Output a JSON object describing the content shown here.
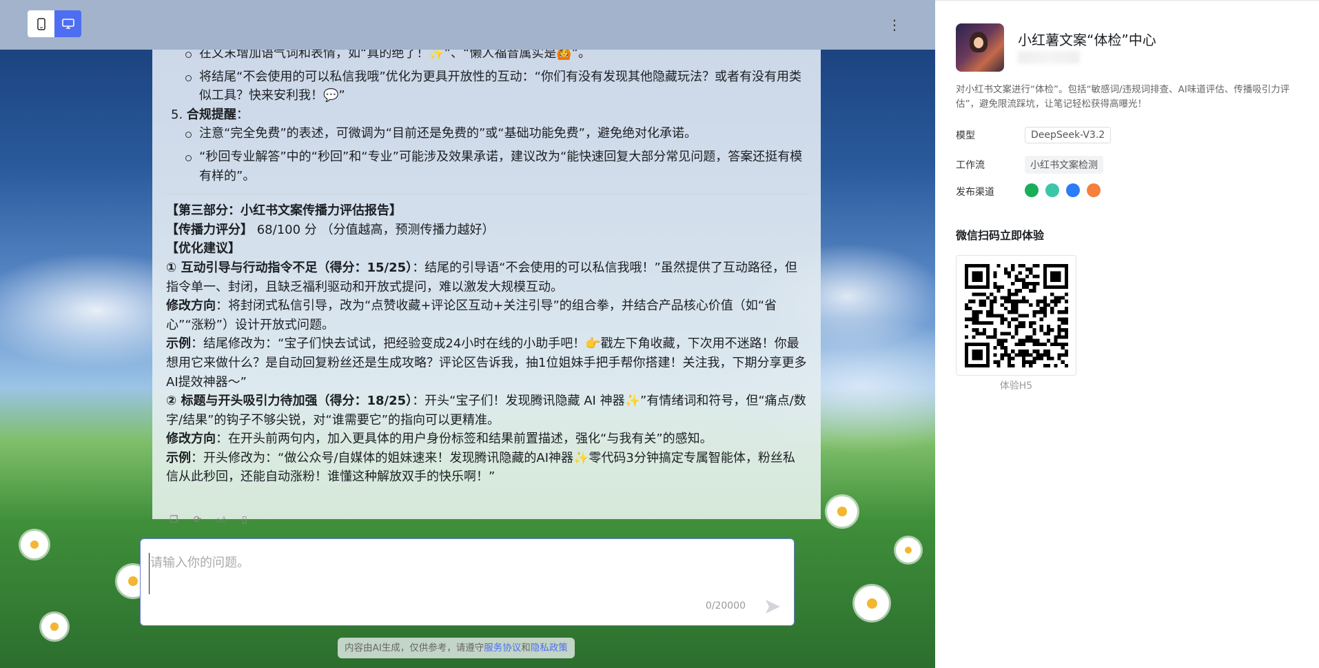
{
  "toolbar": {
    "mobile_icon": "mobile-phone-icon",
    "desktop_icon": "desktop-monitor-icon",
    "more_icon": "more-vertical-icon",
    "more_glyph": "⋮"
  },
  "chat": {
    "partial_line": "在文末增加语气词和表情，如“真的绝了！✨”、“懒人福音属实是🙆”。",
    "bullet_interaction": "将结尾“不会使用的可以私信我哦”优化为更具开放性的互动：“你们有没有发现其他隐藏玩法？或者有没有用类似工具？快来安利我！💬”",
    "item5_num": "5.",
    "item5_title": "合规提醒",
    "item5_colon": "：",
    "item5_bullets": [
      "注意“完全免费”的表述，可微调为“目前还是免费的”或“基础功能免费”，避免绝对化承诺。",
      "“秒回专业解答”中的“秒回”和“专业”可能涉及效果承诺，建议改为“能快速回复大部分常见问题，答案还挺有模有样的”。"
    ],
    "part3_title": "【第三部分：小红书文案传播力评估报告】",
    "score_label": "【传播力评分】",
    "score_value": " 68/100 分 （分值越高，预测传播力越好）",
    "suggest_label": "【优化建议】",
    "s1_title": "① 互动引导与行动指令不足（得分：15/25）",
    "s1_text": "：结尾的引导语“不会使用的可以私信我哦！”虽然提供了互动路径，但指令单一、封闭，且缺乏福利驱动和开放式提问，难以激发大规模互动。",
    "s1_dir_label": "修改方向",
    "s1_dir_text": "：将封闭式私信引导，改为“点赞收藏+评论区互动+关注引导”的组合拳，并结合产品核心价值（如“省心”“涨粉”）设计开放式问题。",
    "s1_ex_label": "示例",
    "s1_ex_text": "：结尾修改为：“宝子们快去试试，把经验变成24小时在线的小助手吧！👉戳左下角收藏，下次用不迷路！你最想用它来做什么？是自动回复粉丝还是生成攻略？评论区告诉我，抽1位姐妹手把手帮你搭建！关注我，下期分享更多AI提效神器～”",
    "s2_title": "② 标题与开头吸引力待加强（得分：18/25）",
    "s2_text": "：开头“宝子们！发现腾讯隐藏 AI 神器✨”有情绪词和符号，但“痛点/数字/结果”的钩子不够尖锐，对“谁需要它”的指向可以更精准。",
    "s2_dir_label": "修改方向",
    "s2_dir_text": "：在开头前两句内，加入更具体的用户身份标签和结果前置描述，强化“与我有关”的感知。",
    "s2_ex_label": "示例",
    "s2_ex_text": "：开头修改为：“做公众号/自媒体的姐妹速来！发现腾讯隐藏的AI神器✨零代码3分钟搞定专属智能体，粉丝私信从此秒回，还能自动涨粉！谁懂这种解放双手的快乐啊！”"
  },
  "input": {
    "placeholder": "请输入你的问题。",
    "count": "0/20000",
    "send_icon": "send-icon"
  },
  "disclaimer": {
    "text": "内容由AI生成，仅供参考，请遵守",
    "link1": "服务协议",
    "and": "和",
    "link2": "隐私政策"
  },
  "side": {
    "title": "小红薯文案“体检”中心",
    "description": "对小红书文案进行“体检”。包括“敏感词/违规词排查、AI味道评估、传播吸引力评估”，避免限流踩坑，让笔记轻松获得高曝光！",
    "model_label": "模型",
    "model_value": "DeepSeek-V3.2",
    "workflow_label": "工作流",
    "workflow_value": "小红书文案检测",
    "channel_label": "发布渠道",
    "channels": [
      {
        "icon": "channel-green-icon",
        "color": "#1aad5a"
      },
      {
        "icon": "channel-teal-icon",
        "color": "#3cc6a8"
      },
      {
        "icon": "channel-colorful-icon",
        "color": "#2b7cf6"
      },
      {
        "icon": "channel-orange-icon",
        "color": "#f5803e"
      }
    ],
    "qr_title": "微信扫码立即体验",
    "qr_label": "体验H5"
  },
  "colors": {
    "accent": "#4e6ef2"
  }
}
